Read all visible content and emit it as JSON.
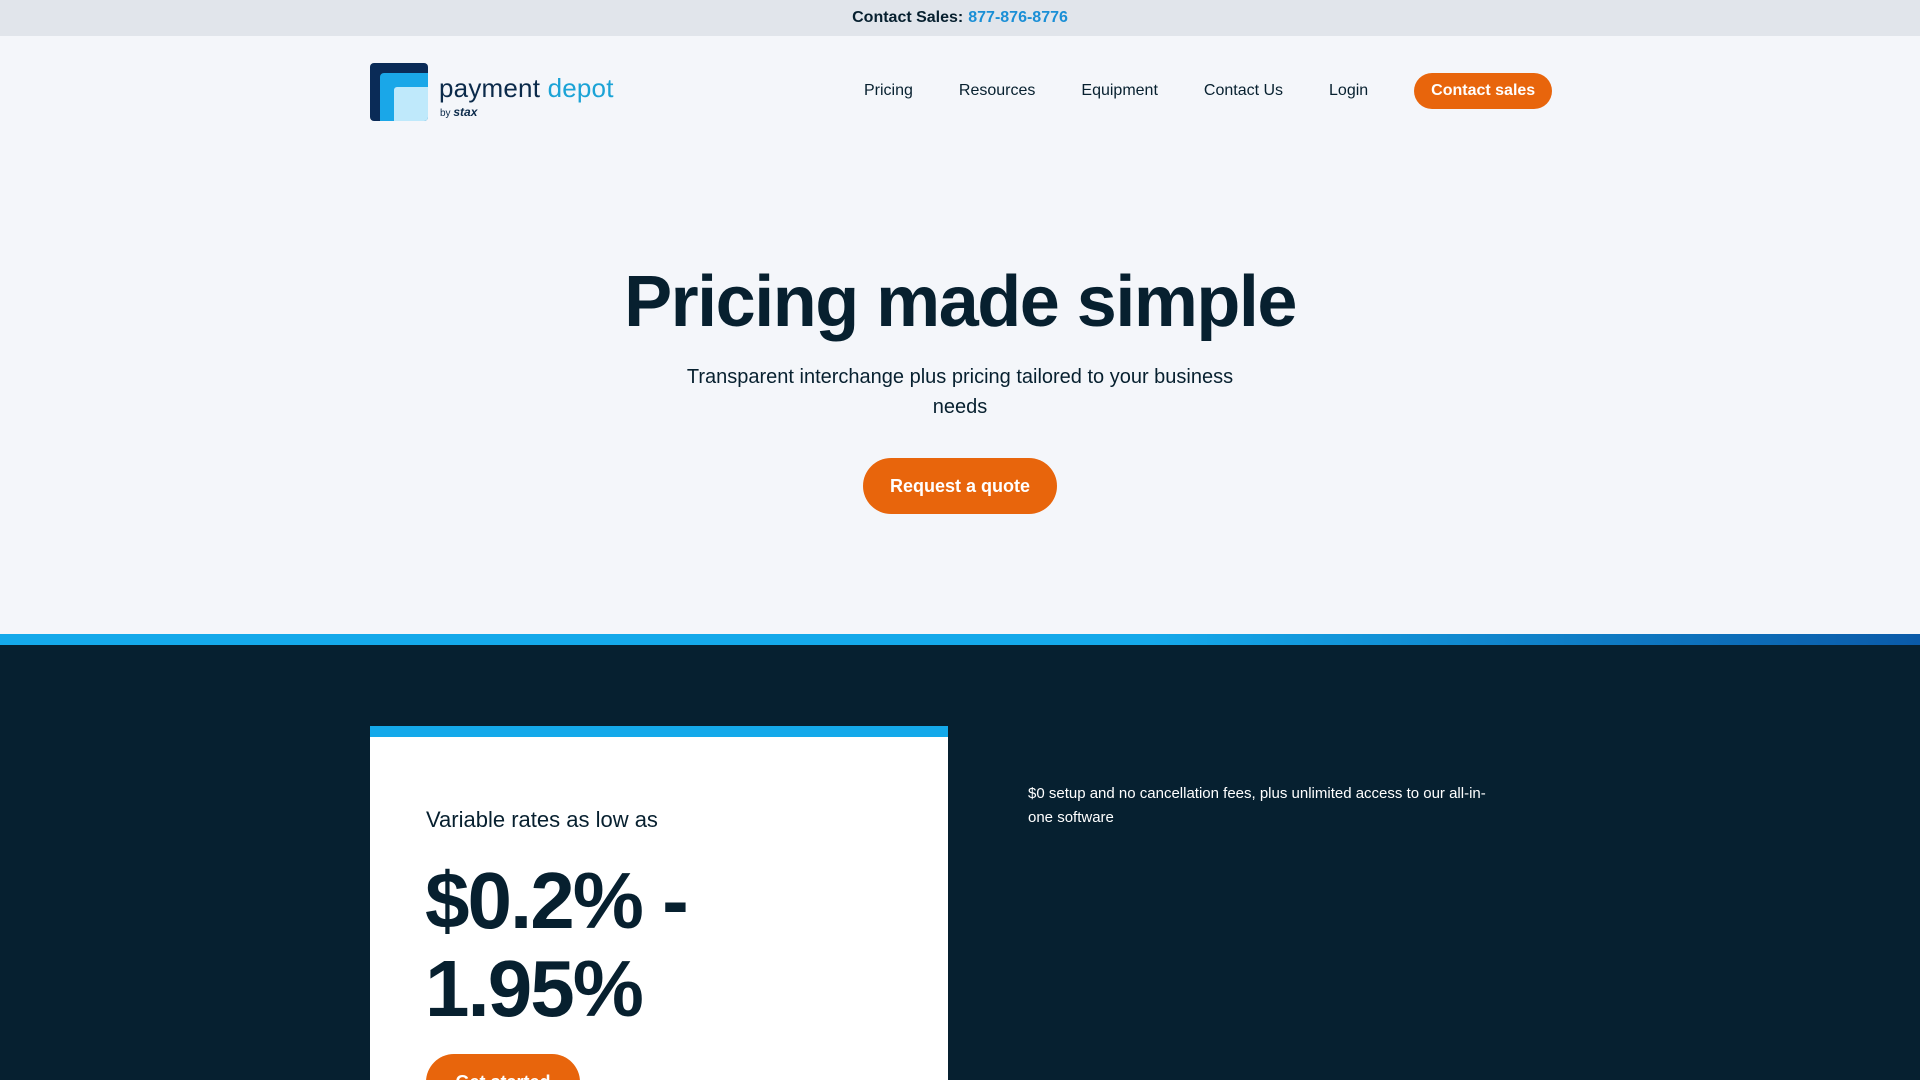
{
  "topbar": {
    "label": "Contact Sales:",
    "phone": "877-876-8776"
  },
  "logo": {
    "word_payment": "payment",
    "word_depot": "depot",
    "by": "by",
    "brand": "stax"
  },
  "nav": {
    "items": [
      {
        "label": "Pricing"
      },
      {
        "label": "Resources"
      },
      {
        "label": "Equipment"
      },
      {
        "label": "Contact Us"
      },
      {
        "label": "Login"
      }
    ],
    "cta_label": "Contact sales"
  },
  "hero": {
    "title": "Pricing made simple",
    "subtitle": "Transparent interchange plus pricing tailored to your business needs",
    "cta_label": "Request a quote"
  },
  "pricing_card": {
    "label": "Variable rates as low as",
    "rate": "$0.2% - 1.95%",
    "cta_label": "Get started"
  },
  "side": {
    "text": "$0 setup and no cancellation fees, plus unlimited access to our all-in-one software"
  },
  "colors": {
    "accent_orange": "#e8650c",
    "brand_blue": "#14a9ea",
    "dark_navy": "#062030",
    "link_blue": "#1a8fd6"
  }
}
